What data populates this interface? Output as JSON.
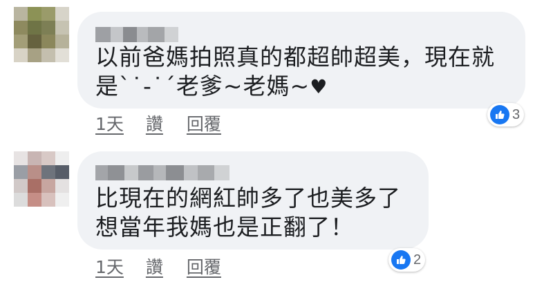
{
  "comments": [
    {
      "author_name": "",
      "text_lines": [
        "以前爸媽拍照真的都超帥超美，現在就",
        "是ˋ˙-˙ˊ老爹~老媽~"
      ],
      "has_heart": true,
      "reactions": {
        "icon": "thumbs-up-icon",
        "count": "3"
      },
      "time": "1天",
      "like_label": "讚",
      "reply_label": "回覆",
      "avatar_colors": [
        "#b9b5a0",
        "#8c9256",
        "#9a9b6a",
        "#d7d4c9",
        "#8e8a5f",
        "#6f7446",
        "#7d7f55",
        "#c6c3b2",
        "#a39e78",
        "#66623f",
        "#8b875b",
        "#b6b29a",
        "#d8d3c6",
        "#a7a184",
        "#c4bfae",
        "#e2dfd7"
      ],
      "name_blur_colors": [
        "#9ea0a4",
        "#c4c6c9",
        "#8a8c90",
        "#b9bbbe",
        "#a3a5a8",
        "#d0d2d4"
      ]
    },
    {
      "author_name": "",
      "text_lines": [
        "比現在的網紅帥多了也美多了",
        "想當年我媽也是正翻了！"
      ],
      "has_heart": false,
      "reactions": {
        "icon": "thumbs-up-icon",
        "count": "2"
      },
      "time": "1天",
      "like_label": "讚",
      "reply_label": "回覆",
      "avatar_colors": [
        "#e7e3e3",
        "#c8b5b3",
        "#d8c9c6",
        "#eeeeee",
        "#9a9ea5",
        "#b98f88",
        "#6e737c",
        "#575d68",
        "#d1c9c8",
        "#a96f66",
        "#c7a6a0",
        "#e4e1e1",
        "#dcdcdc",
        "#c58e86",
        "#d8c1bd",
        "#efefef"
      ],
      "name_blur_colors": [
        "#a3a5a9",
        "#8f9195",
        "#c7c9cb",
        "#9a9ca0",
        "#b5b7ba",
        "#8c8e92",
        "#c0c2c5",
        "#a8aaad",
        "#d0d2d4"
      ]
    }
  ],
  "colors": {
    "bubble_bg": "#f0f2f5",
    "like_blue": "#1877f2",
    "meta_gray": "#65676b",
    "text": "#1c1e21"
  }
}
